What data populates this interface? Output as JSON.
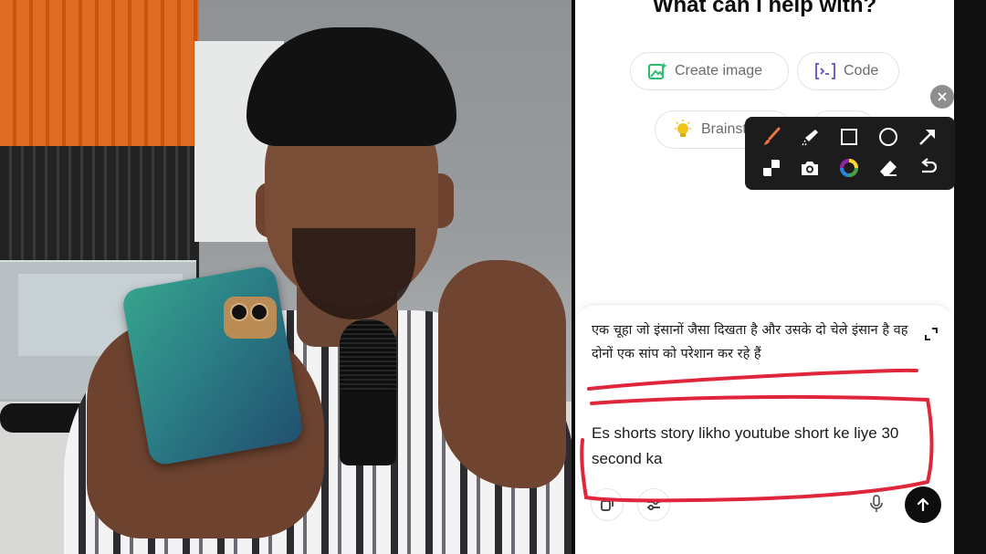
{
  "heading": "What can I help with?",
  "chips": {
    "create_image": "Create image",
    "code": "Code",
    "brainstorm": "Brainstorm"
  },
  "toolbar": {
    "row1": [
      "brush-icon",
      "highlighter-icon",
      "rectangle-icon",
      "circle-icon",
      "arrow-icon"
    ],
    "row2": [
      "mosaic-icon",
      "camera-icon",
      "color-wheel-icon",
      "eraser-icon",
      "undo-icon"
    ]
  },
  "composer": {
    "hindi_prompt": "एक चूहा जो इंसानों जैसा दिखता है और उसके दो चेले इंसान है वह दोनों एक सांप  को परेशान कर रहे हैं",
    "english_prompt": "Es shorts story likho youtube short ke liye 30 second ka"
  },
  "colors": {
    "annotation_red": "#e0263a",
    "send_button": "#0d0d0d",
    "toolbar_bg": "#1c1c1c",
    "create_icon_green": "#2dbd6e",
    "code_icon_purple": "#6c63c9",
    "bulb_yellow": "#f0c419"
  }
}
